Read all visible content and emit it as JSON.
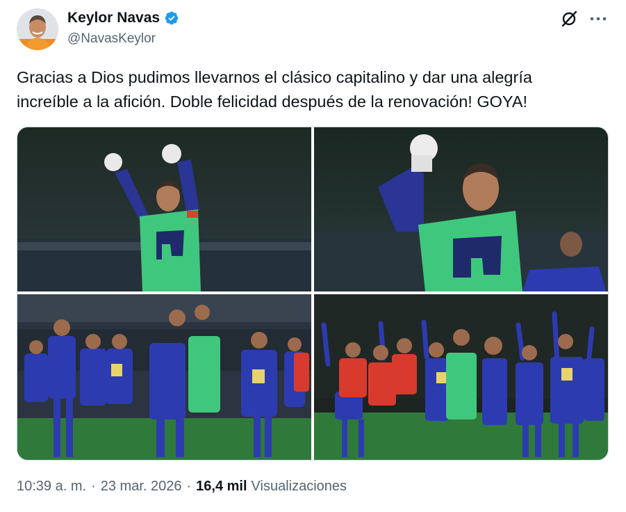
{
  "author": {
    "display_name": "Keylor Navas",
    "handle": "@NavasKeylor",
    "verified": true,
    "avatar_icon": "profile-photo"
  },
  "tweet": {
    "line1": "Gracias a Dios pudimos llevarnos el clásico capitalino y dar una alegría",
    "line2": "increíble a la afición. Doble felicidad después de la renovación! GOYA!"
  },
  "media": {
    "count": 4,
    "photos": [
      {
        "description_icon": "photo-goalkeeper-celebrating-both-fists"
      },
      {
        "description_icon": "photo-goalkeeper-fist-closeup"
      },
      {
        "description_icon": "photo-team-hugging-on-pitch"
      },
      {
        "description_icon": "photo-team-saluting-crowd"
      }
    ]
  },
  "meta": {
    "time": "10:39 a. m.",
    "dot1": "·",
    "date": "23 mar. 2026",
    "dot2": "·",
    "views_count": "16,4 mil",
    "views_label": "Visualizaciones"
  },
  "colors": {
    "verified_blue": "#1d9bf0",
    "text_primary": "#0f1419",
    "text_secondary": "#536471",
    "border": "#cfd9de",
    "jersey_green": "#3fc87d",
    "jersey_blue": "#2d3bb0",
    "pitch_green": "#2f7a3a"
  },
  "icons": {
    "grok": "grok-icon",
    "more": "more-icon"
  }
}
